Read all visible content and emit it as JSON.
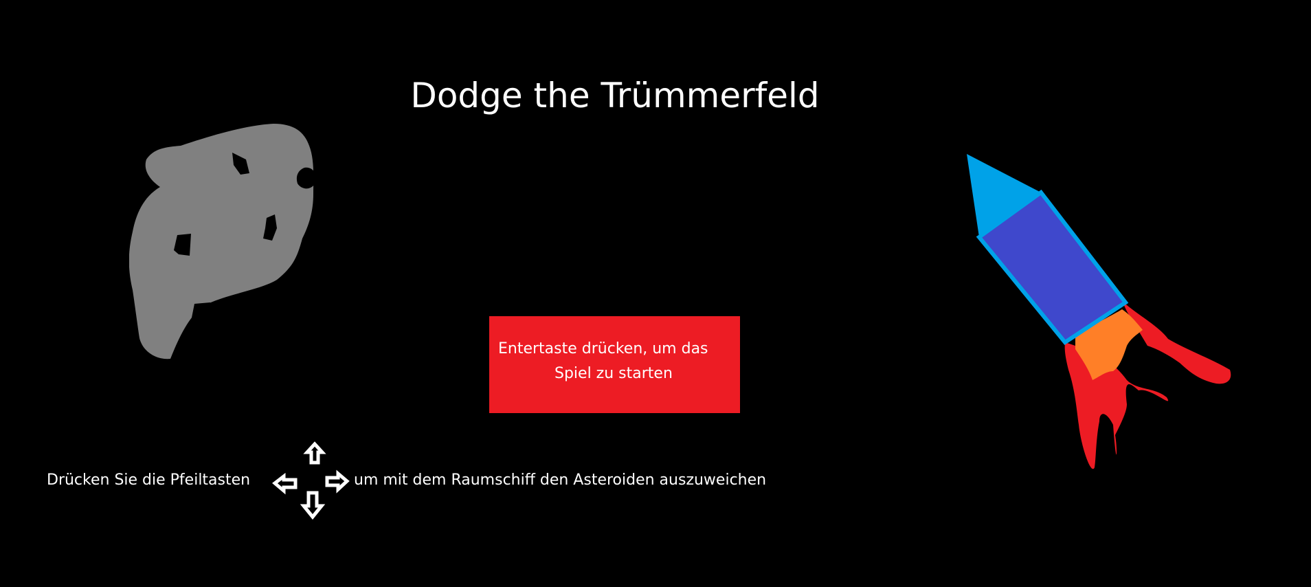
{
  "game": {
    "title": "Dodge the Trümmerfeld",
    "start_prompt": {
      "line1": "Entertaste drücken, um das",
      "line2": "Spiel zu starten"
    },
    "controls_hint": {
      "before": "Drücken Sie die Pfeiltasten",
      "after": "um mit dem Raumschiff den Asteroiden auszuweichen"
    },
    "sprites": {
      "asteroid": "asteroid-sprite",
      "rocket": "rocket-sprite",
      "arrow_keys": [
        "arrow-up-icon",
        "arrow-left-icon",
        "arrow-right-icon",
        "arrow-down-icon"
      ]
    },
    "colors": {
      "background": "#000000",
      "text": "#ffffff",
      "button": "#ed1c24",
      "asteroid": "#808080",
      "rocket_body": "#3f48cc",
      "rocket_nose": "#00a2e8",
      "flame_outer": "#ed1c24",
      "flame_inner": "#ff7f27"
    }
  }
}
